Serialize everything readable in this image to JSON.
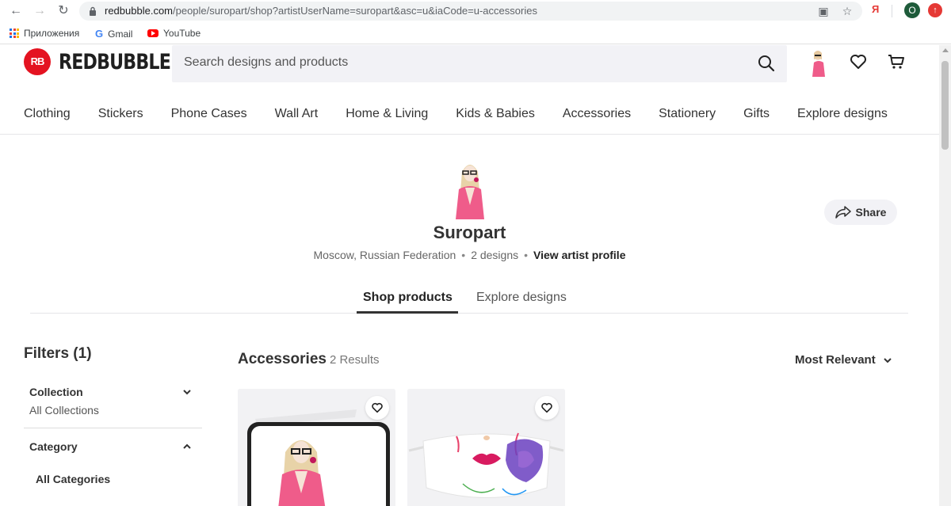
{
  "browser": {
    "url_host": "redbubble.com",
    "url_path": "/people/suropart/shop?artistUserName=suropart&asc=u&iaCode=u-accessories",
    "ext_label": "Я",
    "profile_initial": "O",
    "bookmarks": [
      "Приложения",
      "Gmail",
      "YouTube"
    ]
  },
  "header": {
    "brand_badge": "RB",
    "brand_name": "REDBUBBLE",
    "search_placeholder": "Search designs and products",
    "brand_color": "#e41321"
  },
  "categories": [
    "Clothing",
    "Stickers",
    "Phone Cases",
    "Wall Art",
    "Home & Living",
    "Kids & Babies",
    "Accessories",
    "Stationery",
    "Gifts",
    "Explore designs"
  ],
  "artist": {
    "name": "Suropart",
    "location": "Moscow, Russian Federation",
    "designs": "2 designs",
    "profile_link": "View artist profile",
    "share_label": "Share"
  },
  "tabs": {
    "shop": "Shop products",
    "explore": "Explore designs"
  },
  "filters": {
    "title": "Filters (1)",
    "collection_title": "Collection",
    "collection_value": "All Collections",
    "category_title": "Category",
    "category_value": "All Categories"
  },
  "results": {
    "title": "Accessories",
    "count": "2 Results",
    "sort_label": "Most Relevant"
  },
  "products": [
    {
      "type": "laptop-sleeve",
      "accent": "#e8436b"
    },
    {
      "type": "face-mask",
      "accent": "#6a3fbf"
    }
  ]
}
